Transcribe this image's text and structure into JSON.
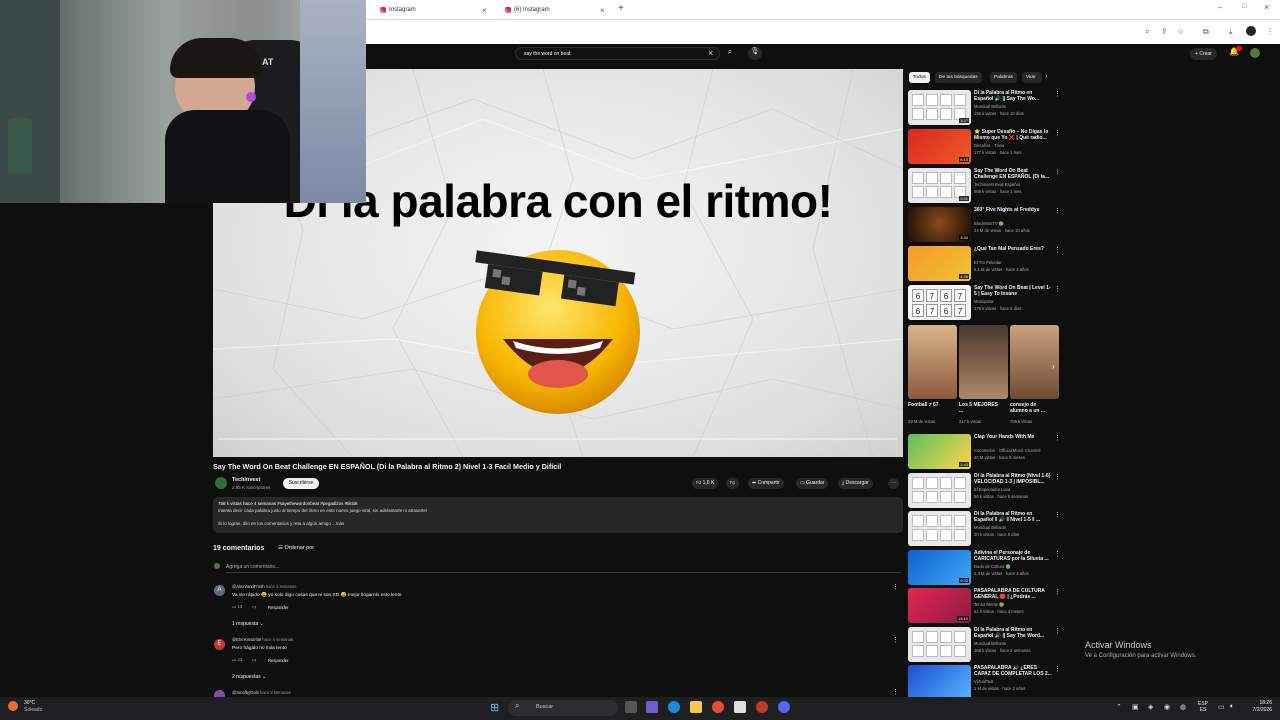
{
  "browser": {
    "tabs": [
      {
        "label": "Instagram"
      },
      {
        "label": "(6) Instagram"
      }
    ]
  },
  "youtube": {
    "search_query": "say the word on beat",
    "create_label": "Crear"
  },
  "video": {
    "overlay_text": "Di la palabra con el ritmo!",
    "title": "Say The Word On Beat Challenge EN ESPAÑOL (Di la Palabra al Ritmo 2) Nivel 1-3 Facil Medio y Difícil",
    "channel": "Techinvest",
    "subscribers": "2,55 K suscriptores",
    "subscribe_label": "Suscribirse",
    "likes": "1,6 K",
    "share_label": "Compartir",
    "save_label": "Guardar",
    "download_label": "Descargar",
    "description": {
      "stats": "758 k vistas  hace 4 semanas  #sayethewordonbeat #pegadizos #tiktok",
      "line1": "Intenta decir cada palabra justo al tiempo del ritmo en este nuevo juego viral, sin adelantarte ni atrasarte!",
      "line2": "Si lo logras, dilo en los comentarios y reta a algún amigo ...más"
    }
  },
  "comments": {
    "count": "19 comentarios",
    "sort_label": "Ordenar por",
    "add_placeholder": "Agrega un comentario...",
    "items": [
      {
        "initial": "A",
        "color": "#5a6e7a",
        "author": "@AlexVandFrosh",
        "time": "hace 3 semanas",
        "text": "Va vie rápido 😀 yo solo digo cosas que ni son XD 😀 mejor llogarnlo esto lento",
        "likes": "13",
        "reply_label": "Responder",
        "replies": "1 respuesta"
      },
      {
        "initial": "E",
        "color": "#c0392b",
        "author": "@ElviYonsarlite",
        "time": "hace 4 semanas",
        "text": "Pero hágalo no más lento",
        "likes": "21",
        "reply_label": "Responder",
        "replies": "2 respuestas"
      },
      {
        "initial": "",
        "color": "#8e44ad",
        "author": "@SmolbyGolz",
        "time": "hace 3 semanas",
        "text": "",
        "likes": "",
        "reply_label": "",
        "replies": ""
      }
    ]
  },
  "sidebar": {
    "chips": [
      "Todos",
      "De tus búsquedas",
      "Palabras",
      "Vide"
    ],
    "recommendations": [
      {
        "title": "Di la Palabra al Ritmo en Español 🔊 || Say The Wo...",
        "channel": "Mundual Brillante",
        "meta": "155 k vistas · hace 10 días",
        "duration": "3:27",
        "thumb": "grid"
      },
      {
        "title": "⭐ Super Desafío – No Digas lo Mismo que Yo ❌ | Qué radio...",
        "channel": "Desafíos · Trivia",
        "meta": "177 k vistas · hace 1 mes",
        "duration": "8:13",
        "thumb": "red"
      },
      {
        "title": "Say The Word On Beat Challenge EN ESPAÑOL (Di la...",
        "channel": "Techinvest Beat Español",
        "meta": "565 k vistas · hace 1 mes",
        "duration": "2:01",
        "thumb": "grid"
      },
      {
        "title": "360° Five Nights at Freddys",
        "channel": "BlackMonTV 🟢",
        "meta": "24 M de vistas · hace 10 años",
        "duration": "3:40",
        "thumb": "dark"
      },
      {
        "title": "¿Qué Tan Mal Pensado Eres?",
        "channel": "El Tío Pekedar",
        "meta": "5,1 M de vistas · hace 3 años",
        "duration": "4:26",
        "thumb": "orange"
      },
      {
        "title": "Say The Word On Beat | Level 1-5 | Easy To Insane",
        "channel": "Monopolar",
        "meta": "176 k vistas · hace 8 días",
        "duration": "",
        "thumb": "digits"
      }
    ],
    "shorts": [
      {
        "title": "Football ≠ 67",
        "meta": "29 M de vistas"
      },
      {
        "title": "Los 5 MEJORES ...",
        "meta": "217 k vistas"
      },
      {
        "title": "consejo de alumno a un ...",
        "meta": "785 k vistas"
      }
    ],
    "recommendations2": [
      {
        "title": "Clap Your Hands With Me",
        "channel": "Cocomelon · Official Music Channel",
        "meta": "40 M vistas · hace 8 meses",
        "duration": "2:43",
        "thumb": "green"
      },
      {
        "title": "Di la Palabra al Ritmo (Nivel 1-6) VELOCIDAD 1-3 | IMPOSIBL...",
        "channel": "El Espectador Luca",
        "meta": "56 k vistas · hace 5 semanas",
        "duration": "",
        "thumb": "grid"
      },
      {
        "title": "Di la Palabra al Ritmo en Español ‖ 🔊 ‖ Nivel 1-5 ‖ ...",
        "channel": "Mundual Brillante",
        "meta": "20 k vistas · hace 5 días",
        "duration": "",
        "thumb": "grid"
      },
      {
        "title": "Adivina el Personaje de CARICATURAS por la Silueta ...",
        "channel": "Dado de Cultura 🟢",
        "meta": "2,3 M de vistas · hace 2 años",
        "duration": "9:33",
        "thumb": "blue"
      },
      {
        "title": "PASAPALABRA DE CULTURA GENERAL 🔴 | ¿Podrás ...",
        "channel": "Tenso Mente 🟢",
        "meta": "51 k vistas · hace 3 meses",
        "duration": "15:10",
        "thumb": "pinkred"
      },
      {
        "title": "Di la Palabra al Ritmo en Español 🔊 || Say The Word...",
        "channel": "Mundual Brillante",
        "meta": "168 k vistas · hace 2 semanas",
        "duration": "",
        "thumb": "grid"
      },
      {
        "title": "PASAPALABRA 🔊 ¿ERES CAPAZ DE COMPLETAR LOS 2...",
        "channel": "VirtualTest",
        "meta": "1 M de vistas · hace 2 años",
        "duration": "",
        "thumb": "blue2"
      }
    ]
  },
  "windows": {
    "activate_title": "Activar Windows",
    "activate_sub": "Ve a Configuración para activar Windows.",
    "weather_temp": "30°C",
    "weather_desc": "Soleado",
    "search_label": "Buscar",
    "lang": "ESP",
    "lang2": "ES",
    "time": "18:26",
    "date": "7/2/2026"
  },
  "colors": {
    "yt_bg": "#0f0f0f",
    "chip_bg": "#272727",
    "accent_red": "#ff0033"
  }
}
